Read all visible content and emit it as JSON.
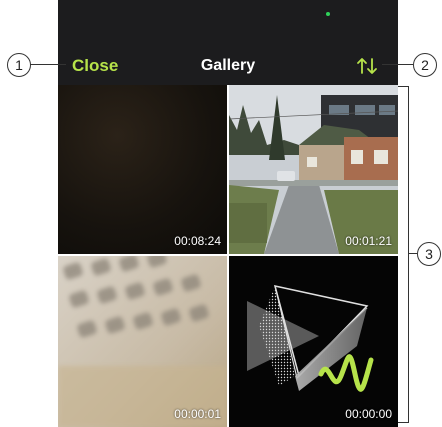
{
  "nav": {
    "close_label": "Close",
    "title": "Gallery",
    "sort_icon": "sort-arrows-icon"
  },
  "videos": [
    {
      "duration": "00:08:24",
      "thumbnail": "dark-frame"
    },
    {
      "duration": "00:01:21",
      "thumbnail": "house-street"
    },
    {
      "duration": "00:00:01",
      "thumbnail": "keyboard-blur"
    },
    {
      "duration": "00:00:00",
      "thumbnail": "abstract-shapes"
    }
  ],
  "callouts": {
    "close": "1",
    "sort": "2",
    "grid": "3"
  },
  "colors": {
    "accent": "#b6e34a",
    "nav_background": "#1c1c1e",
    "status_dot": "#2fd15a"
  }
}
